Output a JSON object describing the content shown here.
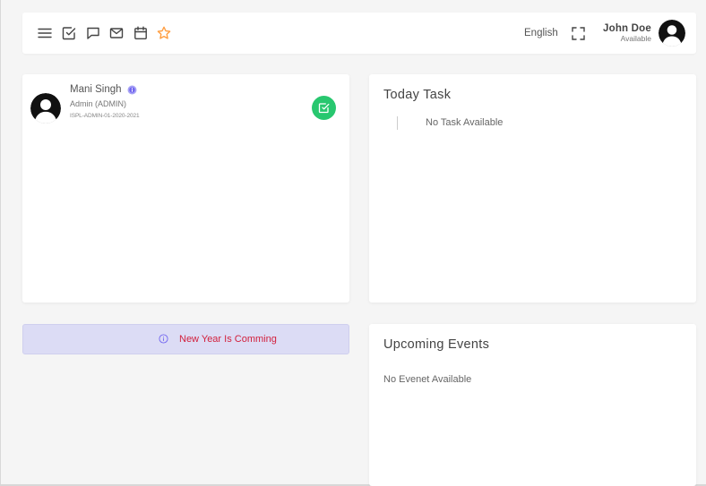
{
  "header": {
    "icons": [
      {
        "name": "menu-icon"
      },
      {
        "name": "todo-icon"
      },
      {
        "name": "chat-icon"
      },
      {
        "name": "email-icon"
      },
      {
        "name": "calendar-icon"
      },
      {
        "name": "star-icon",
        "color": "#ff9f43"
      }
    ],
    "language": "English",
    "user": {
      "name": "John Doe",
      "status": "Available"
    }
  },
  "profile": {
    "name": "Mani Singh",
    "role": "Admin (ADMIN)",
    "id": "ISPL-ADMIN-01-2020-2021",
    "edit_button_color": "#28c76f"
  },
  "notice": {
    "text": "New Year Is Comming",
    "color": "#d21f3c"
  },
  "today_task": {
    "title": "Today Task",
    "empty": "No Task Available"
  },
  "upcoming_events": {
    "title": "Upcoming Events",
    "empty": "No Evenet Available"
  }
}
